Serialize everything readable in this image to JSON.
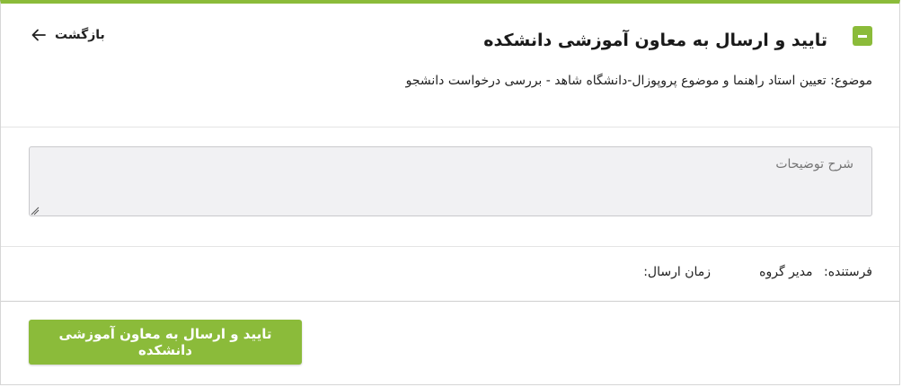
{
  "header": {
    "title": "تایید و ارسال به معاون آموزشی دانشکده",
    "back_label": "بازگشت",
    "subject_label": "موضوع:",
    "subject_value": "تعیین استاد راهنما و موضوع پروپوزال-دانشگاه شاهد - بررسی درخواست دانشجو"
  },
  "description": {
    "placeholder": "شرح توضیحات"
  },
  "meta": {
    "sender_label": "فرستنده:",
    "sender_value": "مدیر گروه",
    "send_time_label": "زمان ارسال:"
  },
  "footer": {
    "submit_label": "تایید و ارسال به معاون آموزشی دانشکده"
  },
  "colors": {
    "accent": "#8bbb3a",
    "text": "#222222",
    "input_bg": "#f1f1f3"
  },
  "icons": {
    "collapse": "minus-icon",
    "back": "arrow-left-icon"
  }
}
